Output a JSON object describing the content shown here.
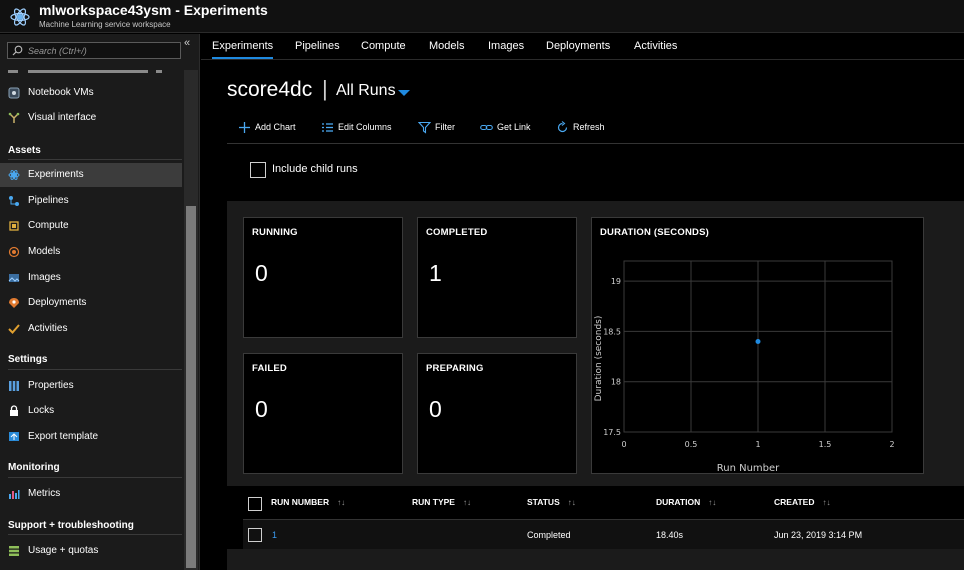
{
  "app": {
    "title": "mlworkspace43ysm - Experiments",
    "subtitle": "Machine Learning service workspace"
  },
  "sidebar": {
    "search_placeholder": "Search (Ctrl+/)",
    "collapse_glyph": "«",
    "items_top": [
      {
        "label": "Notebook VMs",
        "icon": "notebook-vm-icon"
      },
      {
        "label": "Visual interface",
        "icon": "visual-interface-icon"
      }
    ],
    "assets_heading": "Assets",
    "assets": [
      {
        "label": "Experiments",
        "icon": "experiments-icon",
        "active": true
      },
      {
        "label": "Pipelines",
        "icon": "pipelines-icon"
      },
      {
        "label": "Compute",
        "icon": "compute-icon"
      },
      {
        "label": "Models",
        "icon": "models-icon"
      },
      {
        "label": "Images",
        "icon": "images-icon"
      },
      {
        "label": "Deployments",
        "icon": "deployments-icon"
      },
      {
        "label": "Activities",
        "icon": "activities-icon"
      }
    ],
    "settings_heading": "Settings",
    "settings": [
      {
        "label": "Properties",
        "icon": "properties-icon"
      },
      {
        "label": "Locks",
        "icon": "lock-icon"
      },
      {
        "label": "Export template",
        "icon": "export-template-icon"
      }
    ],
    "monitoring_heading": "Monitoring",
    "monitoring": [
      {
        "label": "Metrics",
        "icon": "metrics-icon"
      }
    ],
    "support_heading": "Support + troubleshooting",
    "support": [
      {
        "label": "Usage + quotas",
        "icon": "usage-quotas-icon"
      }
    ]
  },
  "tabs": [
    "Experiments",
    "Pipelines",
    "Compute",
    "Models",
    "Images",
    "Deployments",
    "Activities"
  ],
  "active_tab": "Experiments",
  "header": {
    "experiment_name": "score4dc",
    "separator": "|",
    "run_filter": "All Runs"
  },
  "toolbar": {
    "add_chart": "Add Chart",
    "edit_columns": "Edit Columns",
    "filter": "Filter",
    "get_link": "Get Link",
    "refresh": "Refresh"
  },
  "include_child_runs": {
    "label": "Include child runs",
    "checked": false
  },
  "summary": {
    "running": {
      "label": "RUNNING",
      "value": "0"
    },
    "completed": {
      "label": "COMPLETED",
      "value": "1"
    },
    "failed": {
      "label": "FAILED",
      "value": "0"
    },
    "preparing": {
      "label": "PREPARING",
      "value": "0"
    }
  },
  "chart_data": {
    "type": "scatter",
    "title": "DURATION (SECONDS)",
    "xlabel": "Run Number",
    "ylabel": "Duration (seconds)",
    "xlim": [
      0,
      2
    ],
    "ylim": [
      17.5,
      19.2
    ],
    "xticks": [
      "0",
      "0.5",
      "1",
      "1.5",
      "2"
    ],
    "yticks": [
      "17.5",
      "18",
      "18.5",
      "19"
    ],
    "grid": true,
    "series": [
      {
        "x": [
          1
        ],
        "y": [
          18.4
        ],
        "color": "#1f8ae0"
      }
    ]
  },
  "table": {
    "headers": [
      "RUN NUMBER",
      "RUN TYPE",
      "STATUS",
      "DURATION",
      "CREATED"
    ],
    "sort_glyphs": [
      "↑↓",
      "↑↓",
      "↑↓",
      "↑↓",
      "↑↓"
    ],
    "rows": [
      {
        "run_number": "1",
        "run_type": "",
        "status": "Completed",
        "duration": "18.40s",
        "created": "Jun 23, 2019 3:14 PM"
      }
    ]
  },
  "colors": {
    "accent": "#1f8ae0",
    "link": "#3a9bf0",
    "active_item": "#3c3c3c"
  }
}
